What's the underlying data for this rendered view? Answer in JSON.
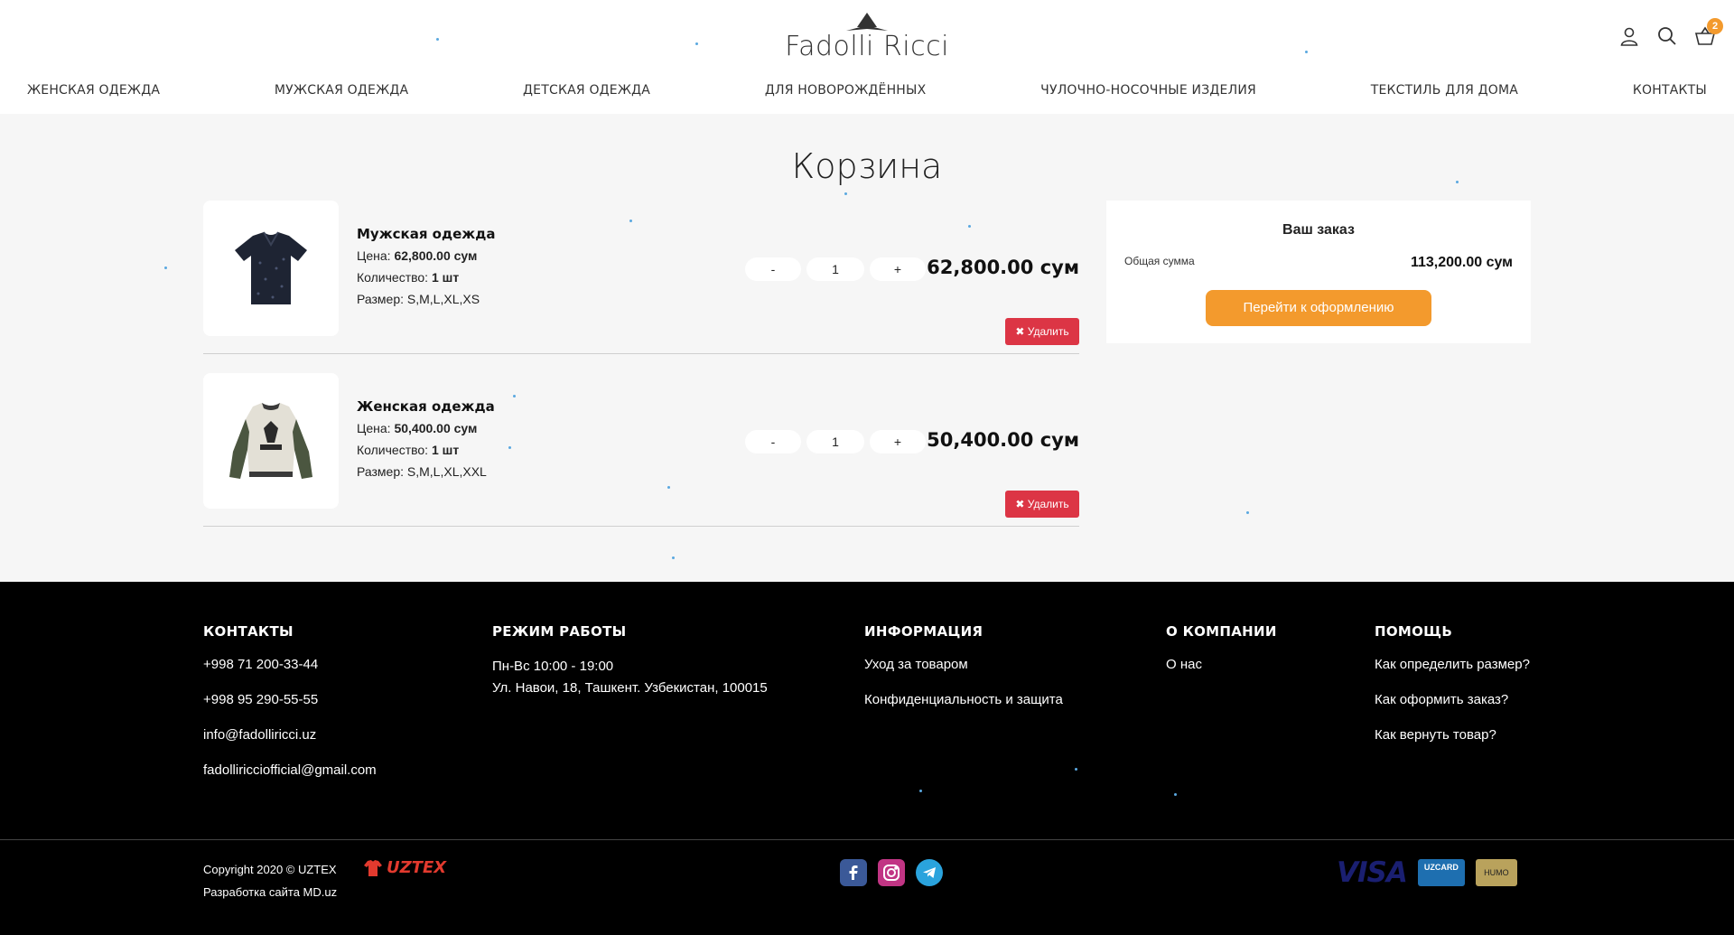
{
  "brand": {
    "name": "Fadolli Ricci",
    "accent": "#f39a2d",
    "danger": "#dc3545"
  },
  "header": {
    "cart_count": "2"
  },
  "nav": [
    "ЖЕНСКАЯ ОДЕЖДА",
    "МУЖСКАЯ ОДЕЖДА",
    "ДЕТСКАЯ ОДЕЖДА",
    "ДЛЯ НОВОРОЖДЁННЫХ",
    "ЧУЛОЧНО-НОСОЧНЫЕ ИЗДЕЛИЯ",
    "ТЕКСТИЛЬ ДЛЯ ДОМА",
    "КОНТАКТЫ"
  ],
  "page_title": "Корзина",
  "cart": {
    "labels": {
      "price": "Цена:",
      "quantity": "Количество:",
      "size": "Размер:",
      "minus": "-",
      "plus": "+",
      "delete": "✖ Удалить"
    },
    "items": [
      {
        "name": "Мужская одежда",
        "price": "62,800.00 сум",
        "quantity": "1 шт",
        "sizes": "S,M,L,XL,XS",
        "qty_value": "1",
        "total": "62,800.00 сум",
        "image_icon": "polo-shirt-icon"
      },
      {
        "name": "Женская одежда",
        "price": "50,400.00 сум",
        "quantity": "1 шт",
        "sizes": "S,M,L,XL,XXL",
        "qty_value": "1",
        "total": "50,400.00 сум",
        "image_icon": "sweatshirt-icon"
      }
    ]
  },
  "order": {
    "title": "Ваш заказ",
    "sum_label": "Общая сумма",
    "sum_value": "113,200.00 сум",
    "checkout_label": "Перейти к оформлению"
  },
  "footer": {
    "contacts": {
      "title": "КОНТАКТЫ",
      "items": [
        "+998 71 200-33-44",
        "+998 95 290-55-55",
        "info@fadolliricci.uz",
        "fadolliricciofficial@gmail.com"
      ]
    },
    "hours": {
      "title": "РЕЖИМ РАБОТЫ",
      "schedule": "Пн-Вс 10:00 - 19:00",
      "address": "Ул. Навои, 18, Ташкент. Узбекистан, 100015"
    },
    "info": {
      "title": "ИНФОРМАЦИЯ",
      "items": [
        "Уход за товаром",
        "Конфиденциальность и защита"
      ]
    },
    "company": {
      "title": "О КОМПАНИИ",
      "items": [
        "О нас"
      ]
    },
    "help": {
      "title": "ПОМОЩЬ",
      "items": [
        "Как определить размер?",
        "Как оформить заказ?",
        "Как вернуть товар?"
      ]
    },
    "copyright": "Copyright 2020 © UZTEX",
    "dev": "Разработка сайта MD.uz",
    "uztex_logo": "UZTEX",
    "social_icons": [
      "facebook-icon",
      "instagram-icon",
      "telegram-icon"
    ],
    "payments": {
      "visa": "VISA",
      "uzcard": "UZCARD",
      "humo": "HUMO"
    }
  }
}
